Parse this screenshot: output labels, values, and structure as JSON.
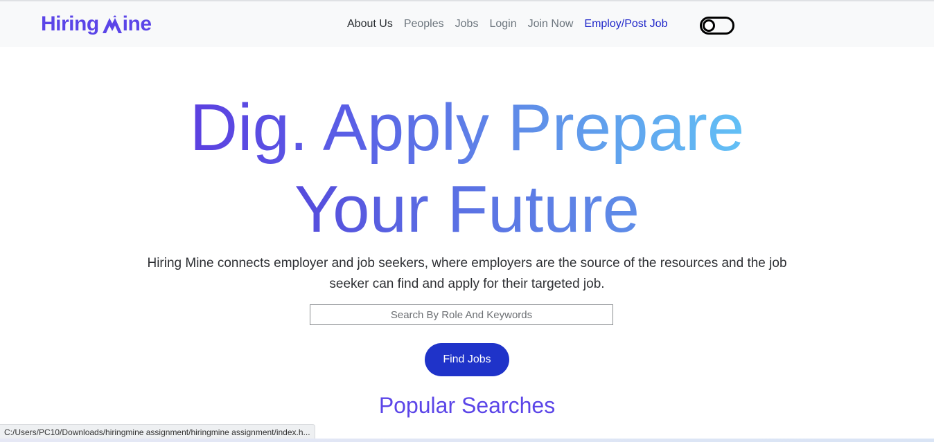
{
  "brand": {
    "name_part1": "Hiring",
    "name_part2": "ine",
    "full_name": "Hiring Mine",
    "color": "#5b45e8"
  },
  "nav": {
    "items": [
      {
        "label": "About Us"
      },
      {
        "label": "Peoples"
      },
      {
        "label": "Jobs"
      },
      {
        "label": "Login"
      },
      {
        "label": "Join Now"
      },
      {
        "label": "Employ/Post Job"
      }
    ]
  },
  "theme_toggle": {
    "icon": "toggle-switch-icon",
    "state": "off"
  },
  "hero": {
    "line1_a": "Dig. Apply",
    "line1_b": "Prepare",
    "line2": "Your Future",
    "description": "Hiring Mine connects employer and job seekers, where employers are the source of the resources and the job seeker can find and apply for their targeted job."
  },
  "search": {
    "placeholder": "Search By Role And Keywords",
    "value": ""
  },
  "find_button": {
    "label": "Find Jobs",
    "color": "#1f33c9"
  },
  "popular": {
    "heading": "Popular Searches"
  },
  "status_bar": {
    "url": "C:/Users/PC10/Downloads/hiringmine assignment/hiringmine assignment/index.h..."
  }
}
